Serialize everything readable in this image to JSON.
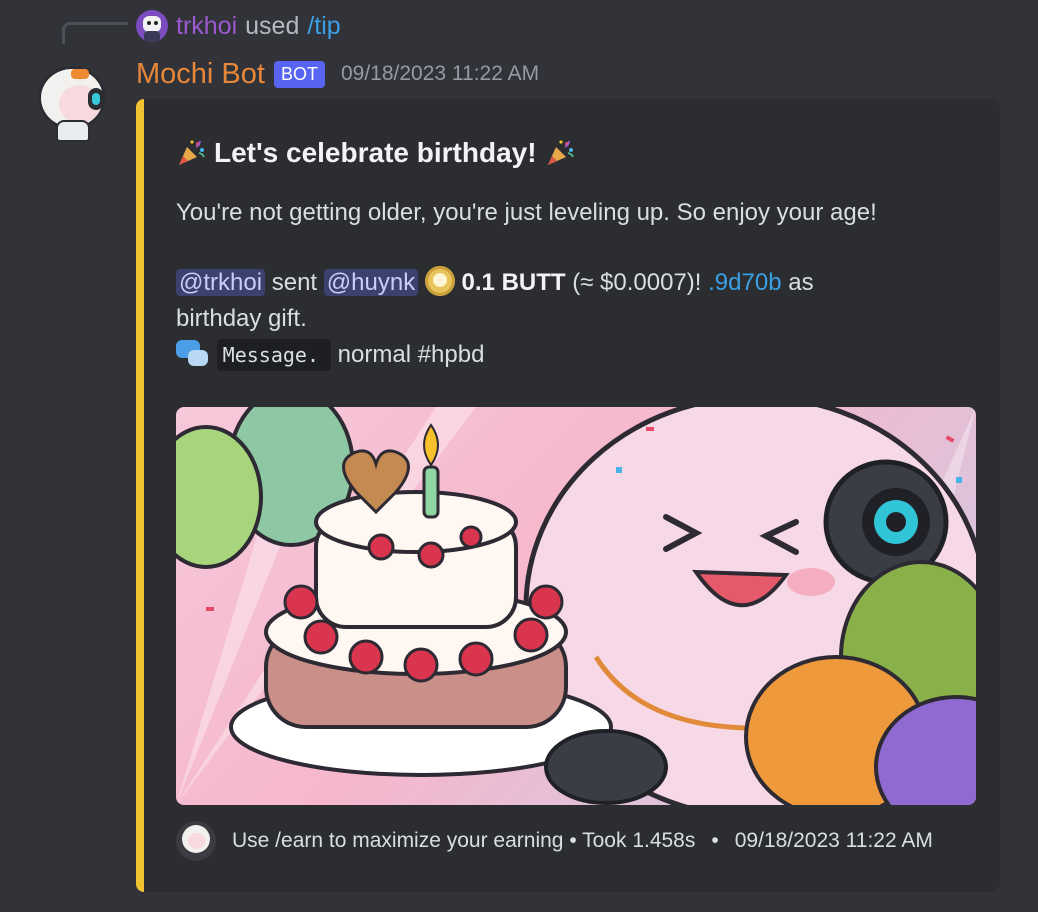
{
  "reference": {
    "user": "trkhoi",
    "verb": "used",
    "command": "/tip"
  },
  "message": {
    "author": "Mochi Bot",
    "tag": "BOT",
    "timestamp": "09/18/2023 11:22 AM"
  },
  "embed": {
    "accent_color": "#f1c232",
    "title": "Let's celebrate birthday!",
    "title_emoji": "party-popper-icon",
    "subtitle": "You're not getting older, you're just leveling up. So enjoy your age!",
    "sender_mention": "@trkhoi",
    "sent_word": "sent",
    "recipient_mention": "@huynk",
    "amount": "0.1 BUTT",
    "usd_value": "(≈ $0.0007)!",
    "tx_link": ".9d70b",
    "as_word": "as",
    "gift_text": "birthday gift.",
    "message_code": "Message.",
    "message_tail": "normal #hpbd",
    "footer_text": "Use /earn to maximize your earning • Took 1.458s",
    "footer_separator": "•",
    "footer_timestamp": "09/18/2023 11:22 AM"
  },
  "colors": {
    "background": "#313338",
    "embed_background": "#2b2d31",
    "bot_name": "#e6873a",
    "bot_tag": "#5865f2",
    "mention_bg": "#3c4270",
    "link": "#3aa0e6",
    "ref_user": "#9b59d0"
  }
}
